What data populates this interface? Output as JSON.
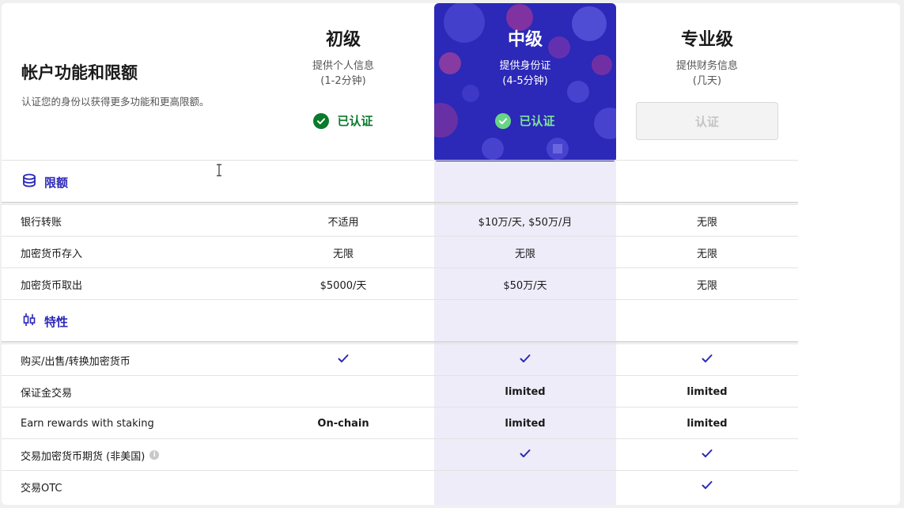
{
  "header": {
    "title": "帐户功能和限额",
    "subtitle": "认证您的身份以获得更多功能和更高限额。"
  },
  "tiers": [
    {
      "name": "初级",
      "desc1": "提供个人信息",
      "desc2": "(1-2分钟)",
      "status": "已认证"
    },
    {
      "name": "中级",
      "desc1": "提供身份证",
      "desc2": "(4-5分钟)",
      "status": "已认证"
    },
    {
      "name": "专业级",
      "desc1": "提供财务信息",
      "desc2": "(几天)",
      "button": "认证"
    }
  ],
  "sections": {
    "limits": {
      "title": "限额",
      "icon": "coins-stack-icon"
    },
    "features": {
      "title": "特性",
      "icon": "candlestick-chart-icon"
    }
  },
  "limit_rows": [
    {
      "label": "银行转账",
      "values": [
        "不适用",
        "$10万/天, $50万/月",
        "无限"
      ]
    },
    {
      "label": "加密货币存入",
      "values": [
        "无限",
        "无限",
        "无限"
      ]
    },
    {
      "label": "加密货币取出",
      "values": [
        "$5000/天",
        "$50万/天",
        "无限"
      ]
    }
  ],
  "feature_rows": [
    {
      "label": "购买/出售/转换加密货币",
      "values": [
        "✓",
        "✓",
        "✓"
      ]
    },
    {
      "label": "保证金交易",
      "values": [
        "",
        "limited",
        "limited"
      ]
    },
    {
      "label": "Earn rewards with staking",
      "values": [
        "On-chain",
        "limited",
        "limited"
      ]
    },
    {
      "label": "交易加密货币期货 (非美国)",
      "values": [
        "",
        "✓",
        "✓"
      ],
      "info": "i"
    },
    {
      "label": "交易OTC",
      "values": [
        "",
        "",
        "✓"
      ]
    }
  ],
  "colors": {
    "accent": "#2c28b8",
    "verified": "#0a7a2b",
    "limited": "#5b4fd1",
    "band": "#eeecf9"
  }
}
